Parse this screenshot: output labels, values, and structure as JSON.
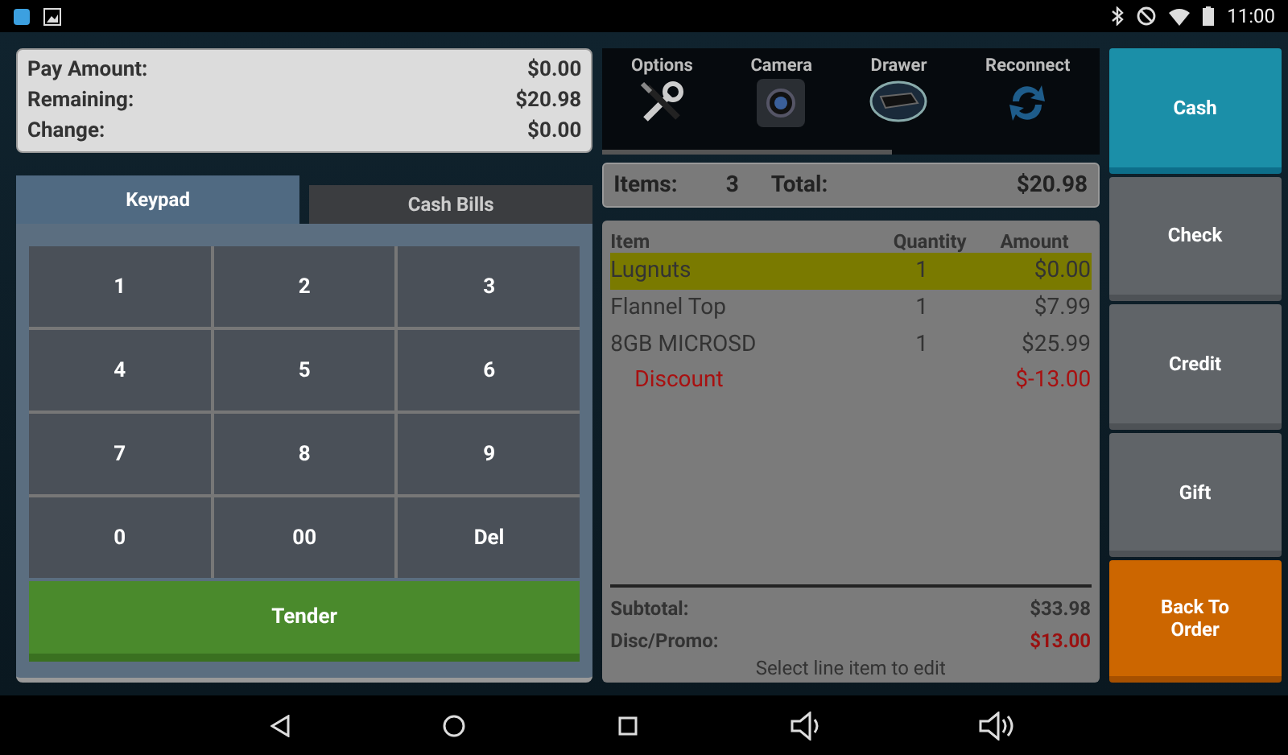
{
  "status_bar": {
    "time": "11:00"
  },
  "summary": [
    {
      "label": "Pay Amount:",
      "value": "$0.00"
    },
    {
      "label": "Remaining:",
      "value": "$20.98"
    },
    {
      "label": "Change:",
      "value": "$0.00"
    }
  ],
  "tabs": [
    {
      "label": "Keypad",
      "selected": true
    },
    {
      "label": "Cash Bills",
      "selected": false
    }
  ],
  "keypad": {
    "keys": [
      "1",
      "2",
      "3",
      "4",
      "5",
      "6",
      "7",
      "8",
      "9",
      "0",
      "00",
      "Del"
    ],
    "tender": "Tender"
  },
  "toolbar": [
    {
      "label": "Options",
      "kind": "tools"
    },
    {
      "label": "Camera",
      "kind": "camera"
    },
    {
      "label": "Drawer",
      "kind": "drawer"
    },
    {
      "label": "Reconnect",
      "kind": "reconnect"
    }
  ],
  "totals_bar": {
    "items_label": "Items:",
    "items": "3",
    "total_label": "Total:",
    "total": "$20.98"
  },
  "order": {
    "columns": [
      "Item",
      "Quantity",
      "Amount"
    ],
    "rows": [
      {
        "kind": "item",
        "name": "Lugnuts",
        "quantity": "1",
        "amount": "$0.00",
        "selected": true
      },
      {
        "kind": "item",
        "name": "Flannel Top",
        "quantity": "1",
        "amount": "$7.99",
        "selected": false
      },
      {
        "kind": "item",
        "name": "8GB MICROSD",
        "quantity": "1",
        "amount": "$25.99",
        "selected": false
      },
      {
        "kind": "discount",
        "name": "Discount",
        "amount": "$-13.00",
        "selected": false
      }
    ],
    "subtotal_label": "Subtotal:",
    "subtotal": "$33.98",
    "promo_label": "Disc/Promo:",
    "promo": "$13.00",
    "hint": "Select line item to edit"
  },
  "payment_buttons": [
    {
      "label": "Cash",
      "kind": "tender",
      "selected": true
    },
    {
      "label": "Check",
      "kind": "tender",
      "selected": false
    },
    {
      "label": "Credit",
      "kind": "tender",
      "selected": false
    },
    {
      "label": "Gift",
      "kind": "tender",
      "selected": false
    },
    {
      "label": "Back To Order",
      "kind": "action",
      "selected": false
    }
  ]
}
